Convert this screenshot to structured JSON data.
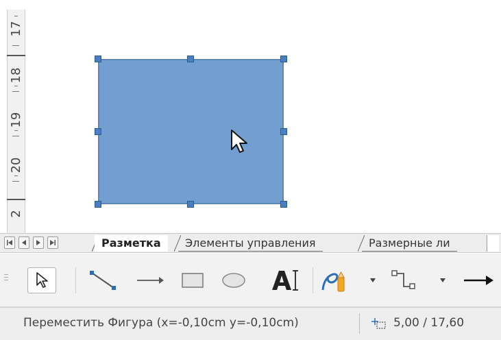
{
  "ruler": {
    "labels": [
      "17",
      "18",
      "19",
      "20",
      "2"
    ]
  },
  "tabs": {
    "nav_first": "first-sheet-icon",
    "nav_prev": "prev-sheet-icon",
    "nav_next": "next-sheet-icon",
    "nav_last": "last-sheet-icon",
    "items": [
      {
        "label": "Разметка",
        "active": true
      },
      {
        "label": "Элементы управления",
        "active": false
      },
      {
        "label": "Размерные ли",
        "active": false
      }
    ]
  },
  "toolbar": {
    "tools": [
      {
        "name": "select-icon"
      },
      {
        "name": "line-icon"
      },
      {
        "name": "arrow-line-icon"
      },
      {
        "name": "rectangle-icon"
      },
      {
        "name": "ellipse-icon"
      },
      {
        "name": "text-icon"
      },
      {
        "name": "curve-icon"
      },
      {
        "name": "connector-icon"
      },
      {
        "name": "line-ends-arrow-icon"
      }
    ]
  },
  "status": {
    "message": "Переместить Фигура (x=-0,10cm y=-0,10cm)",
    "position": "5,00 / 17,60"
  },
  "colors": {
    "shape_fill": "#729fcf",
    "shape_border": "#5a86b8",
    "handle": "#4a7ebf"
  }
}
